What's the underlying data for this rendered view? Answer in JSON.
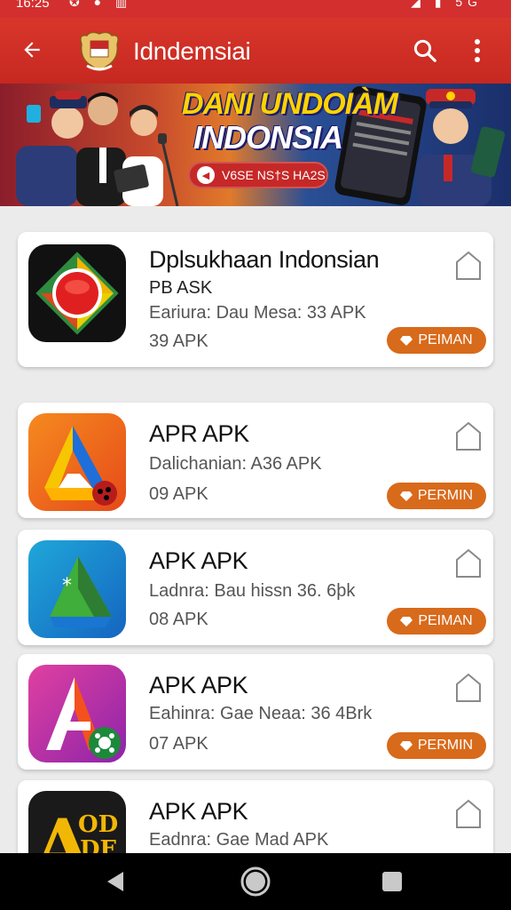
{
  "status": {
    "time": "16:25",
    "right": "5G"
  },
  "appbar": {
    "title": "Idndemsiai"
  },
  "banner": {
    "headline1": "DANI UNDOIÀM",
    "headline2": "INDONSIA",
    "pill_label": "V6SE NS†S HA2S"
  },
  "apps": [
    {
      "name": "Dplsukhaan Indonsian",
      "subtitle": "PB ASK",
      "meta": "Earіura: Dau Mesa: 33 APK",
      "size": "39 APK",
      "button": "PEIMAN"
    },
    {
      "name": "APR APK",
      "subtitle": "",
      "meta": "Dalichanian: A36 APK",
      "size": "09 APK",
      "button": "PERMIN"
    },
    {
      "name": "APK APK",
      "subtitle": "",
      "meta": "Ladnra: Bau hissn 36. 6þk",
      "size": "08 APK",
      "button": "PEIMAN"
    },
    {
      "name": "APK APK",
      "subtitle": "",
      "meta": "Eahinra: Gae Neaa: 36 4Brk",
      "size": "07 APK",
      "button": "PERMIN"
    },
    {
      "name": "APK APK",
      "subtitle": "",
      "meta": "Eadnra: Gae Mad APK",
      "size": "",
      "button": ""
    }
  ],
  "icons": [
    "back-arrow-icon",
    "emblem-logo-icon",
    "search-icon",
    "more-vert-icon",
    "bookmark-icon",
    "nav-back-icon",
    "nav-home-icon",
    "nav-recents-icon"
  ],
  "colors": {
    "appbar": "#c62820",
    "button": "#d86a1b",
    "card": "#ffffff"
  }
}
